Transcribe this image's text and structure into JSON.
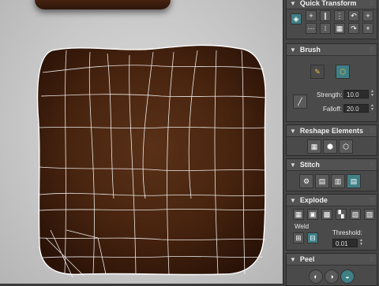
{
  "colors": {
    "panel_bg": "#444444",
    "accent_teal": "#3f7f86",
    "wire": "#ffffff",
    "toast_dark": "#3a1c0d"
  },
  "panel": {
    "quick_transform": {
      "title": "Quick Transform"
    },
    "brush": {
      "title": "Brush",
      "strength_label": "Strength:",
      "strength_value": "10.0",
      "falloff_label": "Falloff:",
      "falloff_value": "20.0"
    },
    "reshape": {
      "title": "Reshape Elements"
    },
    "stitch": {
      "title": "Stitch"
    },
    "explode": {
      "title": "Explode",
      "weld_label": "Weld",
      "threshold_label": "Threshold:",
      "threshold_value": "0.01"
    },
    "peel": {
      "title": "Peel"
    }
  }
}
